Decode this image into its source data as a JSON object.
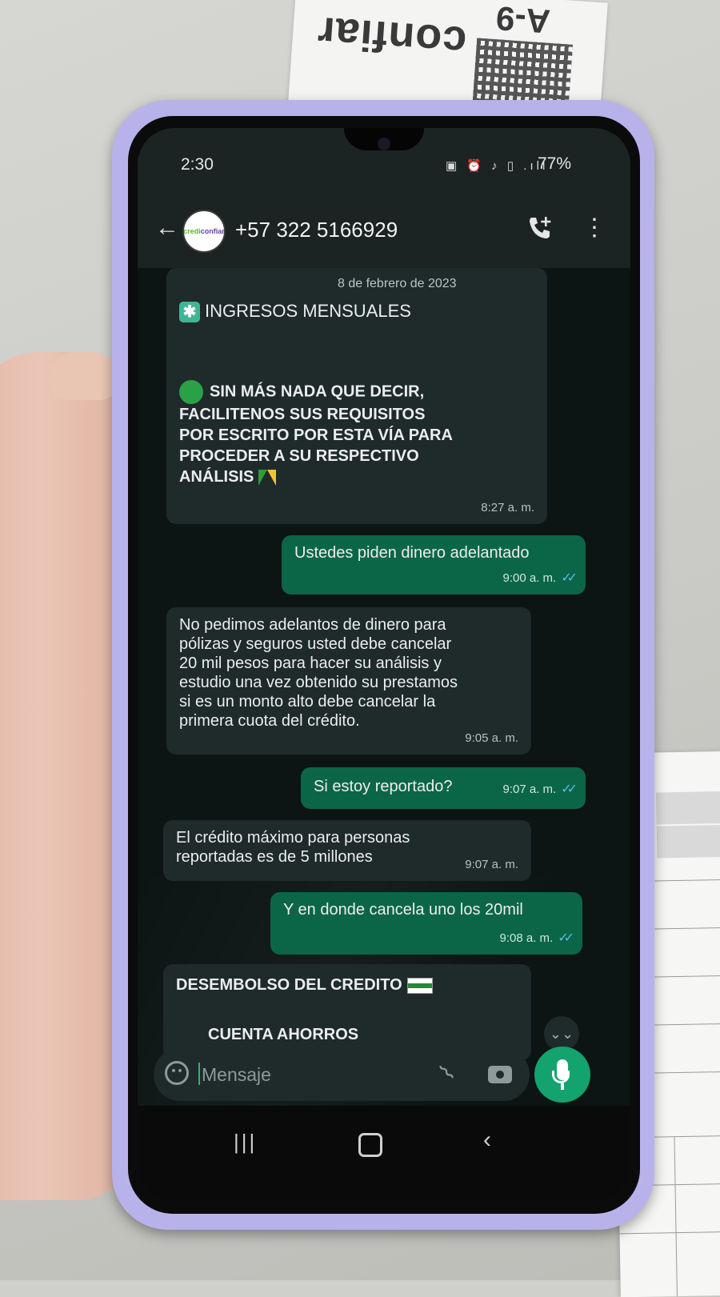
{
  "background": {
    "receipt_brand": "confiar",
    "receipt_code": "A-9"
  },
  "status_bar": {
    "time": "2:30",
    "icons": "▣ ⏰ ♪ ▯ .ıll",
    "battery": "77%"
  },
  "chat_header": {
    "contact": "+57 322 5166929",
    "avatar_text_1": "credi",
    "avatar_text_2": "confiar"
  },
  "messages": {
    "date_label": "8 de febrero de 2023",
    "m1": {
      "line1": "INGRESOS MENSUALES",
      "lines": [
        "SIN MÁS NADA QUE DECIR,",
        "FACILITENOS SUS REQUISITOS",
        "POR ESCRITO POR ESTA VÍA PARA",
        "PROCEDER A SU RESPECTIVO",
        "ANÁLISIS"
      ],
      "time": "8:27 a. m."
    },
    "m2": {
      "text": "Ustedes piden dinero adelantado",
      "time": "9:00 a. m."
    },
    "m3": {
      "lines": [
        "No pedimos adelantos de dinero para",
        "pólizas y seguros usted debe cancelar",
        "20 mil pesos para hacer su análisis y",
        "estudio una vez obtenido su prestamos",
        "si es un monto alto debe cancelar la",
        "primera cuota del crédito."
      ],
      "time": "9:05 a. m."
    },
    "m4": {
      "text": "Si estoy reportado?",
      "time": "9:07 a. m."
    },
    "m5": {
      "lines": [
        "El crédito máximo para personas",
        "reportadas es de 5 millones"
      ],
      "time": "9:07 a. m."
    },
    "m6": {
      "text": "Y en donde cancela uno los 20mil",
      "time": "9:08 a. m."
    },
    "m7": {
      "title": "DESEMBOLSO DEL CREDITO",
      "subtitle": "CUENTA AHORROS"
    }
  },
  "input": {
    "placeholder": "Mensaje"
  },
  "icons": {
    "back": "back-arrow-icon",
    "add_call": "add-call-icon",
    "menu": "more-vert-icon",
    "emoji": "emoji-icon",
    "attach": "paperclip-icon",
    "camera": "camera-icon",
    "mic": "mic-icon",
    "read_receipt": "double-check-icon"
  },
  "colors": {
    "incoming_bubble": "#1f2a2b",
    "outgoing_bubble": "#0b6647",
    "read_ticks": "#53bdeb",
    "mic_button": "#14a36e",
    "phone_case": "#b8b2ea"
  }
}
